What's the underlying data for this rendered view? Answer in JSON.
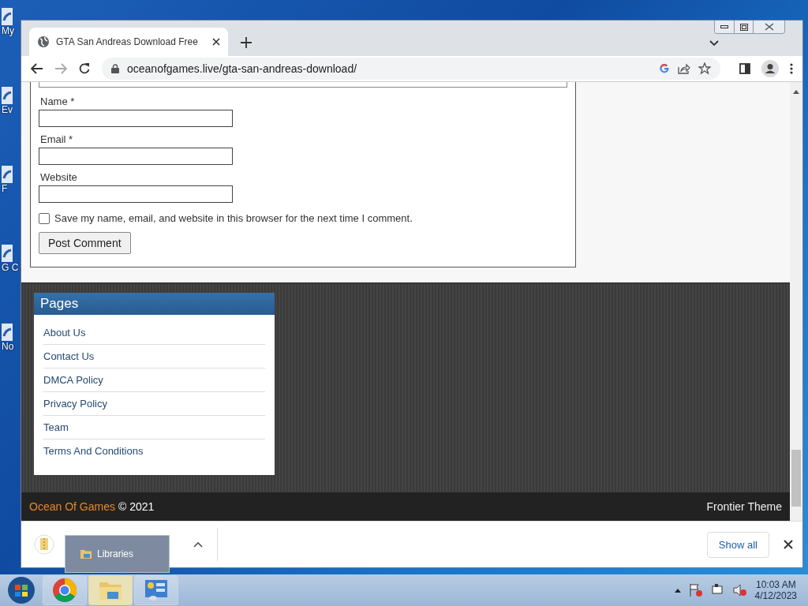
{
  "desktop_icons": [
    {
      "label": "My"
    },
    {
      "label": "Ev"
    },
    {
      "label": "F"
    },
    {
      "label": "G C"
    },
    {
      "label": "No"
    }
  ],
  "browser": {
    "tab": {
      "title": "GTA San Andreas Download Free",
      "selected": true
    },
    "address": "oceanofgames.live/gta-san-andreas-download/"
  },
  "comment_form": {
    "fields": [
      {
        "label": "Name *"
      },
      {
        "label": "Email *"
      },
      {
        "label": "Website"
      }
    ],
    "save_checkbox": {
      "label": "Save my name, email, and website in this browser for the next time I comment.",
      "checked": false
    },
    "submit": "Post Comment"
  },
  "pages_widget": {
    "title": "Pages",
    "items": [
      "About Us",
      "Contact Us",
      "DMCA Policy",
      "Privacy Policy",
      "Team",
      "Terms And Conditions"
    ]
  },
  "footer": {
    "site": "Ocean Of Games",
    "copyright": "© 2021",
    "theme": "Frontier Theme"
  },
  "download_shelf": {
    "show_all": "Show all"
  },
  "tooltip": {
    "label": "Libraries"
  },
  "taskbar": {
    "apps": [
      {
        "kind": "chrome",
        "selected": false
      },
      {
        "kind": "explorer",
        "selected": true
      },
      {
        "kind": "control-panel",
        "selected": false
      }
    ],
    "time": "10:03 AM",
    "date": "4/12/2023"
  }
}
